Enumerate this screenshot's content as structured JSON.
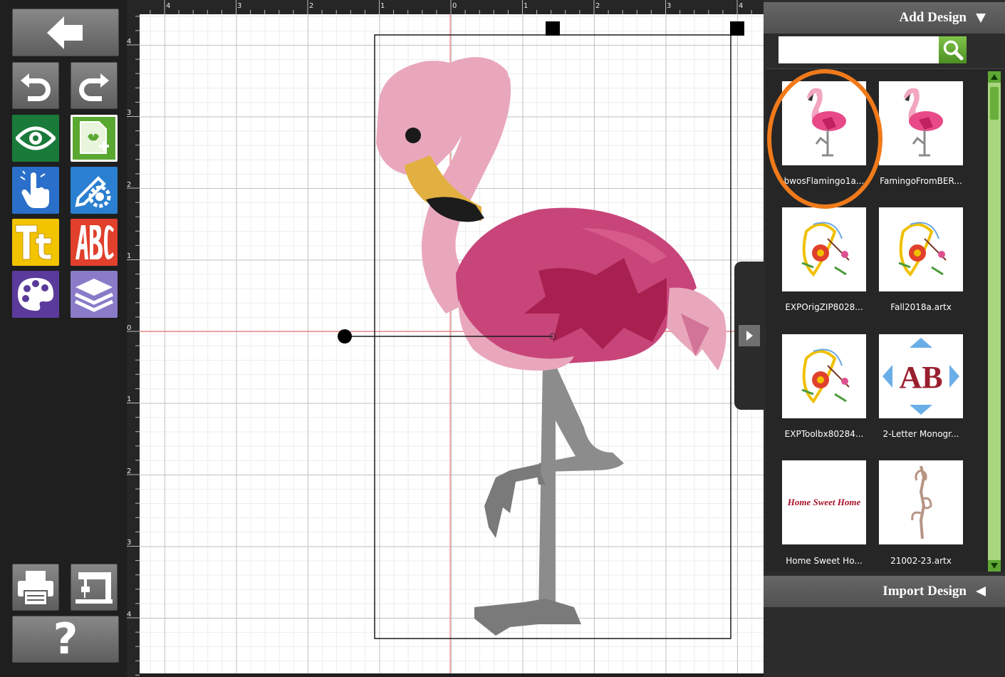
{
  "toolbar": {
    "buttons": [
      {
        "name": "back",
        "icon": "back-arrow-icon"
      },
      {
        "name": "undo",
        "icon": "undo-icon"
      },
      {
        "name": "redo",
        "icon": "redo-icon"
      },
      {
        "name": "preview",
        "icon": "eye-icon",
        "color": "#1a7a3a"
      },
      {
        "name": "add-design",
        "icon": "add-design-icon",
        "color": "#5aa832"
      },
      {
        "name": "select",
        "icon": "pointer-hand-icon",
        "color": "#2a6fc9"
      },
      {
        "name": "edit",
        "icon": "edit-gear-icon",
        "color": "#2a7fd0"
      },
      {
        "name": "text",
        "icon": "text-tt-icon",
        "color": "#f2c400"
      },
      {
        "name": "monogram",
        "icon": "monogram-abc-icon",
        "color": "#e0402c"
      },
      {
        "name": "colors",
        "icon": "palette-icon",
        "color": "#5a3a9a"
      },
      {
        "name": "layers",
        "icon": "layers-icon",
        "color": "#8a7bc8"
      },
      {
        "name": "print",
        "icon": "printer-icon"
      },
      {
        "name": "sew",
        "icon": "sewing-machine-icon"
      },
      {
        "name": "help",
        "icon": "question-icon",
        "label": "?"
      }
    ]
  },
  "rulers": {
    "top_labels": [
      "4",
      "3",
      "2",
      "1",
      "0",
      "1",
      "2",
      "3",
      "4"
    ],
    "left_labels": [
      "4",
      "3",
      "2",
      "1",
      "0",
      "1",
      "2",
      "3",
      "4"
    ]
  },
  "colors": {
    "guide_line": "#ff5a5a",
    "accent_green": "#5ea833",
    "highlight": "#f07a1a",
    "flamingo_light": "#e8a0b8",
    "flamingo_dark": "#c8457a",
    "flamingo_deep": "#a8204f",
    "beak": "#e2b040",
    "leg": "#8c8c8c"
  },
  "right_panel": {
    "add_design_title": "Add Design",
    "import_design_title": "Import Design",
    "search": {
      "value": "",
      "placeholder": ""
    },
    "designs": [
      {
        "label": "bwosFlamingo1a...",
        "kind": "flamingo",
        "selected": true
      },
      {
        "label": "FamingoFromBER...",
        "kind": "flamingo"
      },
      {
        "label": "EXPOrigZIP8028...",
        "kind": "floral"
      },
      {
        "label": "Fall2018a.artx",
        "kind": "floral"
      },
      {
        "label": "EXPToolbx80284...",
        "kind": "floral"
      },
      {
        "label": "2-Letter Monogr...",
        "kind": "monogram",
        "text": "AB"
      },
      {
        "label": "Home Sweet Ho...",
        "kind": "text",
        "text": "Home Sweet Home"
      },
      {
        "label": "21002-23.artx",
        "kind": "stem"
      }
    ]
  }
}
